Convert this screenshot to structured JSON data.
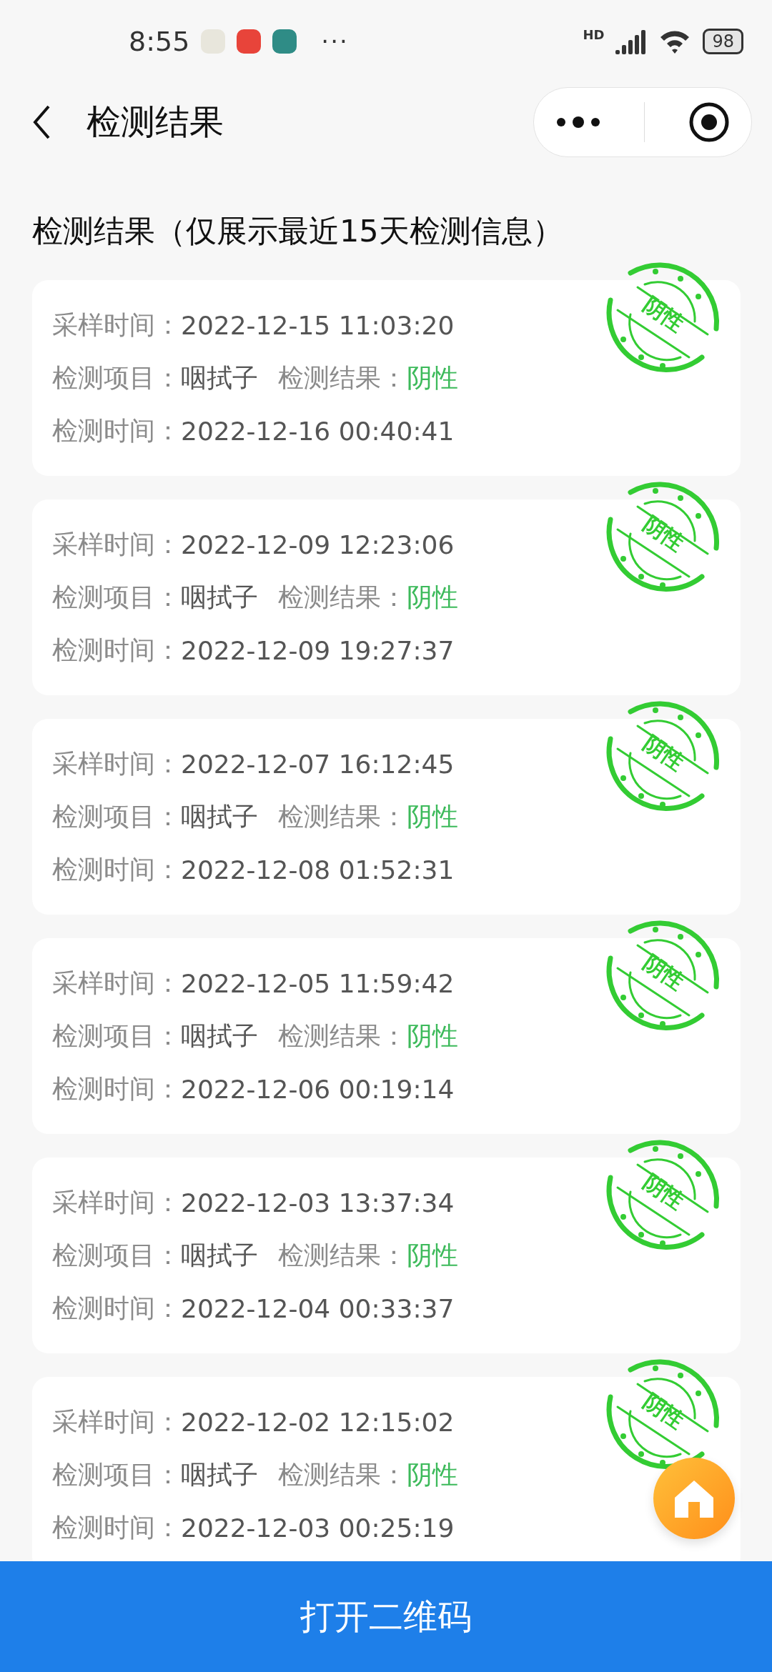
{
  "status_bar": {
    "time": "8:55",
    "more": "···",
    "network": "HD",
    "battery": "98"
  },
  "nav": {
    "title": "检测结果"
  },
  "heading": "检测结果（仅展示最近15天检测信息）",
  "records": [
    {
      "sample_label": "采样时间：",
      "sample_time": "2022-12-15 11:03:20",
      "item_label": "检测项目：",
      "item": "咽拭子",
      "result_label": "检测结果：",
      "result": "阴性",
      "test_label": "检测时间：",
      "test_time": "2022-12-16 00:40:41",
      "stamp": "阴性"
    },
    {
      "sample_label": "采样时间：",
      "sample_time": "2022-12-09 12:23:06",
      "item_label": "检测项目：",
      "item": "咽拭子",
      "result_label": "检测结果：",
      "result": "阴性",
      "test_label": "检测时间：",
      "test_time": "2022-12-09 19:27:37",
      "stamp": "阴性"
    },
    {
      "sample_label": "采样时间：",
      "sample_time": "2022-12-07 16:12:45",
      "item_label": "检测项目：",
      "item": "咽拭子",
      "result_label": "检测结果：",
      "result": "阴性",
      "test_label": "检测时间：",
      "test_time": "2022-12-08 01:52:31",
      "stamp": "阴性"
    },
    {
      "sample_label": "采样时间：",
      "sample_time": "2022-12-05 11:59:42",
      "item_label": "检测项目：",
      "item": "咽拭子",
      "result_label": "检测结果：",
      "result": "阴性",
      "test_label": "检测时间：",
      "test_time": "2022-12-06 00:19:14",
      "stamp": "阴性"
    },
    {
      "sample_label": "采样时间：",
      "sample_time": "2022-12-03 13:37:34",
      "item_label": "检测项目：",
      "item": "咽拭子",
      "result_label": "检测结果：",
      "result": "阴性",
      "test_label": "检测时间：",
      "test_time": "2022-12-04 00:33:37",
      "stamp": "阴性"
    },
    {
      "sample_label": "采样时间：",
      "sample_time": "2022-12-02 12:15:02",
      "item_label": "检测项目：",
      "item": "咽拭子",
      "result_label": "检测结果：",
      "result": "阴性",
      "test_label": "检测时间：",
      "test_time": "2022-12-03 00:25:19",
      "stamp": "阴性"
    }
  ],
  "bottom_button": "打开二维码"
}
